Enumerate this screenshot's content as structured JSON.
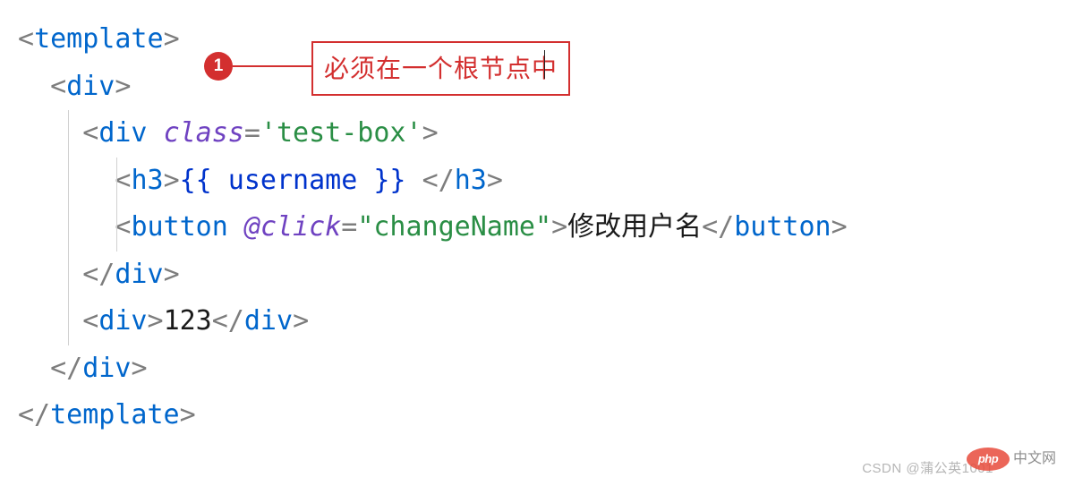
{
  "annotation": {
    "badge": "1",
    "text": "必须在一个根节点中"
  },
  "code": {
    "line1": {
      "open": "<",
      "tag": "template",
      "close": ">"
    },
    "line2": {
      "open": "<",
      "tag": "div",
      "close": ">"
    },
    "line3": {
      "open": "<",
      "tag": "div",
      "attr": "class",
      "eq": "=",
      "q": "'",
      "val": "test-box",
      "close": ">"
    },
    "line4": {
      "open": "<",
      "tag": "h3",
      "close": ">",
      "mustache": "{{ username }}",
      "slash_open": "</",
      "slash_close": ">"
    },
    "line5": {
      "open": "<",
      "tag": "button",
      "at": "@",
      "attr": "click",
      "eq": "=",
      "q": "\"",
      "val": "changeName",
      "close": ">",
      "text": "修改用户名",
      "slash_open": "</",
      "slash_close": ">"
    },
    "line6": {
      "slash_open": "</",
      "tag": "div",
      "close": ">"
    },
    "line7": {
      "open": "<",
      "tag": "div",
      "close": ">",
      "text": "123",
      "slash_open": "</"
    },
    "line8": {
      "slash_open": "</",
      "tag": "div",
      "close": ">"
    },
    "line9": {
      "slash_open": "</",
      "tag": "template",
      "close": ">"
    }
  },
  "watermark": {
    "csdn": "CSDN @蒲公英1001",
    "php_logo": "php",
    "php_text": "中文网"
  }
}
